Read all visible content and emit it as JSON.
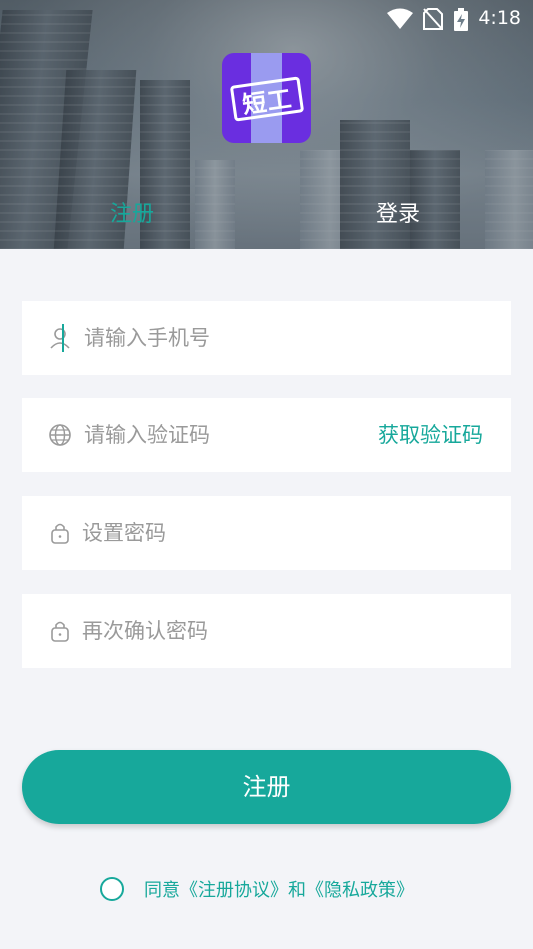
{
  "status_bar": {
    "time": "4:18",
    "icons": [
      "wifi-icon",
      "no-sim-icon",
      "battery-charging-icon"
    ]
  },
  "app": {
    "logo_text": "短工"
  },
  "tabs": [
    {
      "label": "注册",
      "active": true
    },
    {
      "label": "登录",
      "active": false
    }
  ],
  "form": {
    "phone": {
      "placeholder": "请输入手机号",
      "icon": "user-icon"
    },
    "code": {
      "placeholder": "请输入验证码",
      "icon": "globe-icon",
      "action_label": "获取验证码"
    },
    "password": {
      "placeholder": "设置密码",
      "icon": "lock-icon"
    },
    "confirm_password": {
      "placeholder": "再次确认密码",
      "icon": "lock-icon"
    }
  },
  "submit_label": "注册",
  "agreement": {
    "checked": false,
    "text": "同意《注册协议》和《隐私政策》"
  },
  "colors": {
    "accent": "#17a89b",
    "background": "#f3f4f8",
    "logo": "#6a2ee0"
  }
}
